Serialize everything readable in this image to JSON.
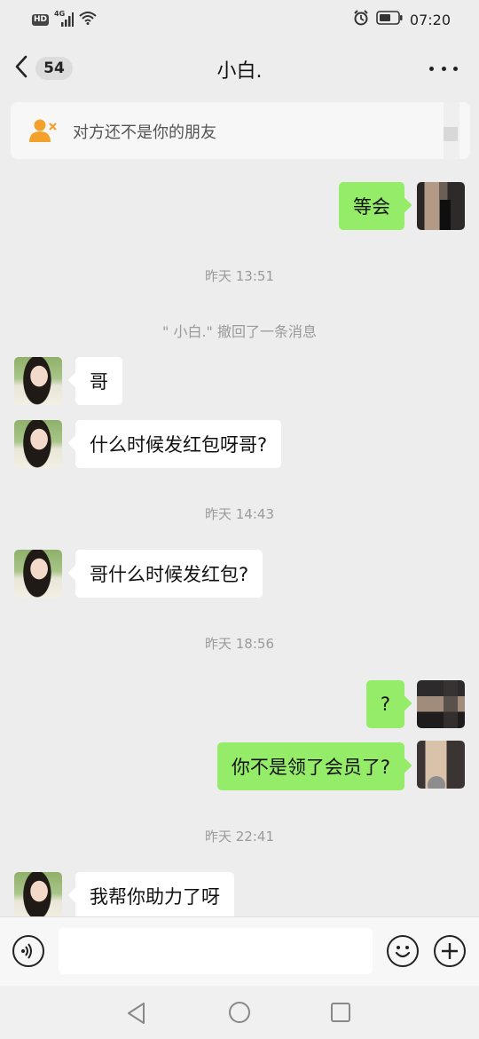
{
  "status_bar": {
    "hd_label": "HD",
    "network_label": "4G",
    "time": "07:20",
    "icons": [
      "signal-icon",
      "wifi-icon",
      "alarm-icon",
      "battery-icon"
    ]
  },
  "header": {
    "unread_count": "54",
    "title": "小白.",
    "icons": [
      "back-arrow-icon",
      "more-icon"
    ]
  },
  "notice": {
    "text": "对方还不是你的朋友",
    "icon": "user-remove-icon",
    "accent_color": "#f2a12b"
  },
  "messages": [
    {
      "type": "out",
      "text": "等会"
    },
    {
      "type": "time",
      "text": "昨天 13:51"
    },
    {
      "type": "system",
      "text": "\" 小白.\" 撤回了一条消息"
    },
    {
      "type": "in",
      "text": "哥"
    },
    {
      "type": "in",
      "text": "什么时候发红包呀哥?"
    },
    {
      "type": "time",
      "text": "昨天 14:43"
    },
    {
      "type": "in",
      "text": "哥什么时候发红包?"
    },
    {
      "type": "time",
      "text": "昨天 18:56"
    },
    {
      "type": "out",
      "text": "?"
    },
    {
      "type": "out",
      "text": "你不是领了会员了?"
    },
    {
      "type": "time",
      "text": "昨天 22:41"
    },
    {
      "type": "in",
      "text": "我帮你助力了呀"
    }
  ],
  "input_bar": {
    "value": "",
    "icons": [
      "voice-icon",
      "emoji-icon",
      "plus-icon"
    ]
  },
  "nav_bar": {
    "icons": [
      "nav-back-icon",
      "nav-home-icon",
      "nav-recents-icon"
    ]
  },
  "colors": {
    "background": "#ededed",
    "outgoing_bubble": "#95ec69",
    "incoming_bubble": "#ffffff"
  }
}
